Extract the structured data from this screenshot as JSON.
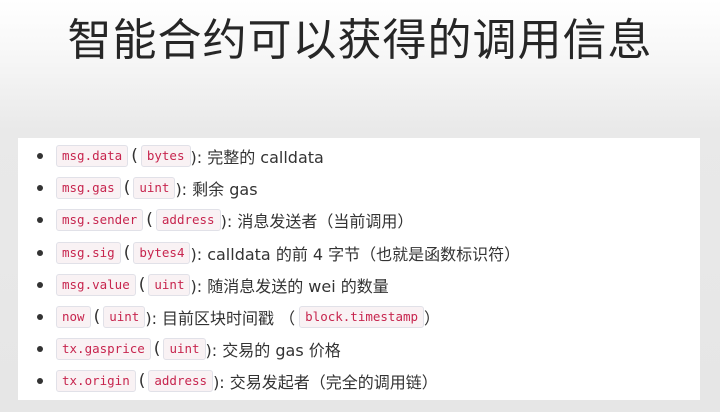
{
  "title": "智能合约可以获得的调用信息",
  "items": [
    {
      "name": "msg.data",
      "type": "bytes",
      "desc": "): 完整的 calldata"
    },
    {
      "name": "msg.gas",
      "type": "uint",
      "desc": "): 剩余 gas"
    },
    {
      "name": "msg.sender",
      "type": "address",
      "desc": "): 消息发送者（当前调用）"
    },
    {
      "name": "msg.sig",
      "type": "bytes4",
      "desc": "): calldata 的前 4 字节（也就是函数标识符）"
    },
    {
      "name": "msg.value",
      "type": "uint",
      "desc": "): 随消息发送的 wei 的数量"
    },
    {
      "name": "now",
      "type": "uint",
      "desc": "): 目前区块时间戳 （",
      "extra_code": "block.timestamp",
      "extra_tail": "）"
    },
    {
      "name": "tx.gasprice",
      "type": "uint",
      "desc": "): 交易的 gas 价格"
    },
    {
      "name": "tx.origin",
      "type": "address",
      "desc": "): 交易发起者（完全的调用链）"
    }
  ]
}
